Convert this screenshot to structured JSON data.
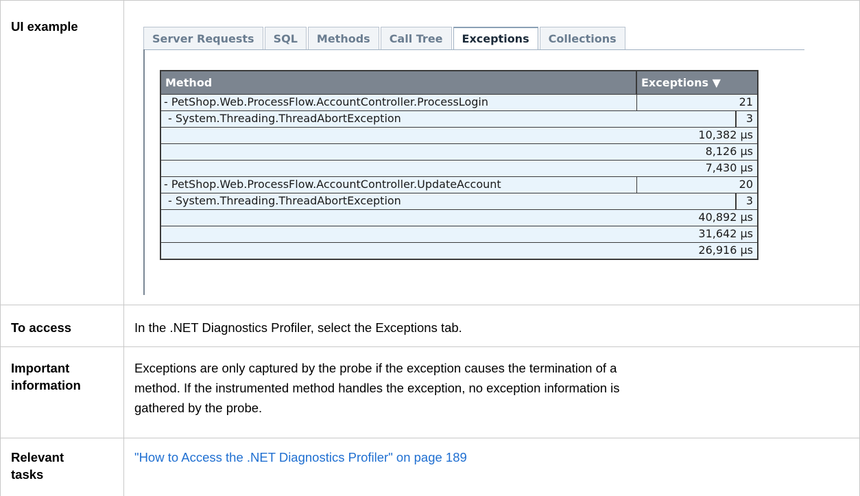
{
  "rows": {
    "ui_example": {
      "label": "UI example"
    },
    "to_access": {
      "label": "To access",
      "text": "In the .NET Diagnostics Profiler, select the Exceptions tab."
    },
    "important": {
      "label_line1": "Important",
      "label_line2": "information",
      "text_line1": "Exceptions are only captured by the probe if the exception causes the termination of a",
      "text_line2": "method. If the instrumented method handles the exception, no exception information is",
      "text_line3": "gathered by the probe."
    },
    "relevant": {
      "label_line1": "Relevant",
      "label_line2": "tasks",
      "link_text": "\"How to Access the .NET Diagnostics Profiler\" on page 189"
    }
  },
  "profiler": {
    "tabs": [
      "Server Requests",
      "SQL",
      "Methods",
      "Call Tree",
      "Exceptions",
      "Collections"
    ],
    "active_tab": "Exceptions",
    "columns": {
      "method": "Method",
      "exceptions": "Exceptions ▼"
    },
    "entries": [
      {
        "kind": "method",
        "name": "- PetShop.Web.ProcessFlow.AccountController.ProcessLogin",
        "value": "21"
      },
      {
        "kind": "child",
        "name": "- System.Threading.ThreadAbortException",
        "value": "3"
      },
      {
        "kind": "timing",
        "name": "",
        "value": "10,382 µs"
      },
      {
        "kind": "timing",
        "name": "",
        "value": "8,126 µs"
      },
      {
        "kind": "timing",
        "name": "",
        "value": "7,430 µs"
      },
      {
        "kind": "method",
        "name": "- PetShop.Web.ProcessFlow.AccountController.UpdateAccount",
        "value": "20"
      },
      {
        "kind": "child",
        "name": "- System.Threading.ThreadAbortException",
        "value": "3"
      },
      {
        "kind": "timing",
        "name": "",
        "value": "40,892 µs"
      },
      {
        "kind": "timing",
        "name": "",
        "value": "31,642 µs"
      },
      {
        "kind": "timing",
        "name": "",
        "value": "26,916 µs"
      }
    ]
  }
}
